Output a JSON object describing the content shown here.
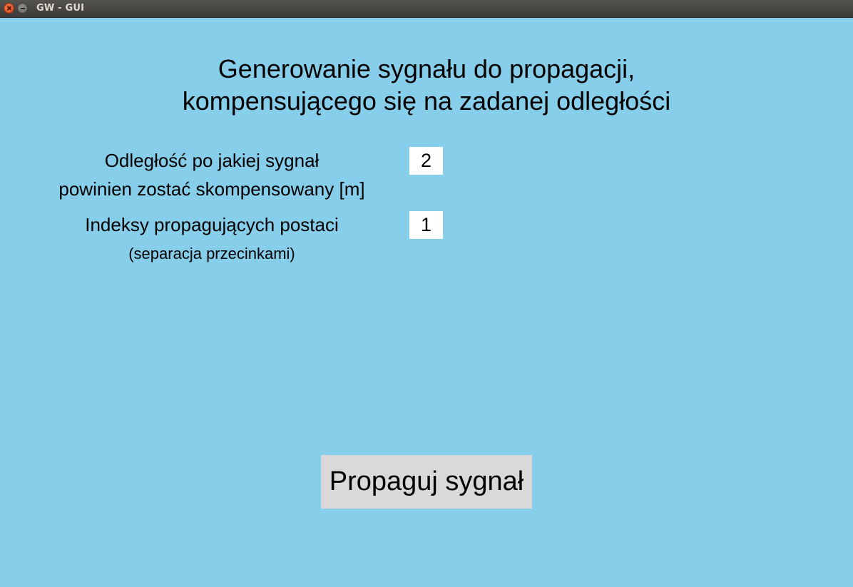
{
  "window": {
    "title": "GW - GUI"
  },
  "heading": {
    "line1": "Generowanie sygnału do propagacji,",
    "line2": "kompensującego się na zadanej odległości"
  },
  "form": {
    "distance": {
      "label_line1": "Odległość po jakiej sygnał",
      "label_line2": "powinien zostać skompensowany [m]",
      "value": "2"
    },
    "indices": {
      "label": "Indeksy propagujących postaci",
      "hint": "(separacja przecinkami)",
      "value": "1"
    }
  },
  "actions": {
    "propagate_label": "Propaguj sygnał"
  },
  "colors": {
    "background": "#87ceeb",
    "button": "#d9d9d9",
    "entry": "#ffffff"
  },
  "icons": {
    "close": "close-icon",
    "minimize": "minimize-icon"
  }
}
